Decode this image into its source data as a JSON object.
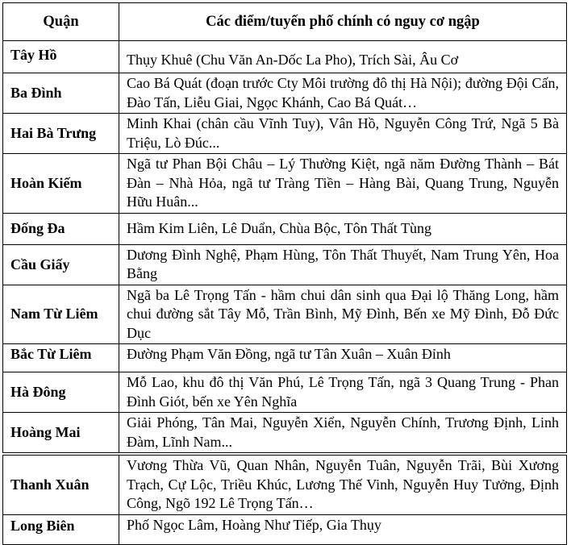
{
  "table": {
    "headers": [
      "Quận",
      "Các điểm/tuyến phố chính có nguy cơ ngập"
    ],
    "rows": [
      {
        "district": "Tây Hồ",
        "streets": "Thụy Khuê (Chu Văn An-Dốc La Pho), Trích Sài, Âu Cơ"
      },
      {
        "district": "Ba Đình",
        "streets": "Cao Bá Quát (đoạn trước Cty Môi trường đô thị Hà Nội); đường Đội Cấn, Đào Tấn, Liễu Giai, Ngọc Khánh, Cao Bá Quát…"
      },
      {
        "district": "Hai Bà Trưng",
        "streets": "Minh Khai (chân cầu Vĩnh Tuy), Vân Hồ, Nguyễn Công Trứ, Ngã 5 Bà Triệu, Lò Đúc..."
      },
      {
        "district": "Hoàn Kiếm",
        "streets": "Ngã tư Phan Bội Châu – Lý Thường Kiệt, ngã năm Đường Thành – Bát Đàn – Nhà Hỏa, ngã tư Tràng Tiền – Hàng Bài, Quang Trung, Nguyễn Hữu Huân..."
      },
      {
        "district": "Đống Đa",
        "streets": "Hầm Kim Liên, Lê Duẩn, Chùa Bộc, Tôn Thất Tùng"
      },
      {
        "district": "Cầu Giấy",
        "streets": "Dương Đình Nghệ, Phạm Hùng, Tôn Thất Thuyết, Nam Trung Yên, Hoa Bằng"
      },
      {
        "district": "Nam Từ Liêm",
        "streets": "Ngã ba Lê Trọng Tấn - hầm chui dân sinh qua Đại lộ Thăng Long, hầm chui đường sắt Tây Mỗ, Trần Bình, Mỹ Đình, Bến xe Mỹ Đình, Đỗ Đức Dục"
      },
      {
        "district": "Bắc Từ Liêm",
        "streets": "Đường Phạm Văn Đồng, ngã tư Tân Xuân – Xuân Đỉnh"
      },
      {
        "district": "Hà Đông",
        "streets": "Mỗ Lao, khu đô thị Văn Phú, Lê Trọng Tấn, ngã 3 Quang Trung - Phan Đình Giót, bến xe Yên Nghĩa"
      },
      {
        "district": "Hoàng Mai",
        "streets": "Giải Phóng, Tân Mai, Nguyễn Xiển, Nguyễn Chính, Trương Định, Linh Đàm, Lĩnh Nam..."
      },
      {
        "district": "Thanh Xuân",
        "streets": "Vương Thừa Vũ, Quan Nhân, Nguyễn Tuân, Nguyễn Trãi, Bùi Xương Trạch, Cự Lộc, Triều Khúc, Lương Thế Vinh, Nguyễn Huy Tưởng, Định Công, Ngõ 192 Lê Trọng Tấn…"
      },
      {
        "district": "Long Biên",
        "streets": "Phố Ngọc Lâm, Hoàng Như Tiếp, Gia Thụy"
      }
    ]
  }
}
